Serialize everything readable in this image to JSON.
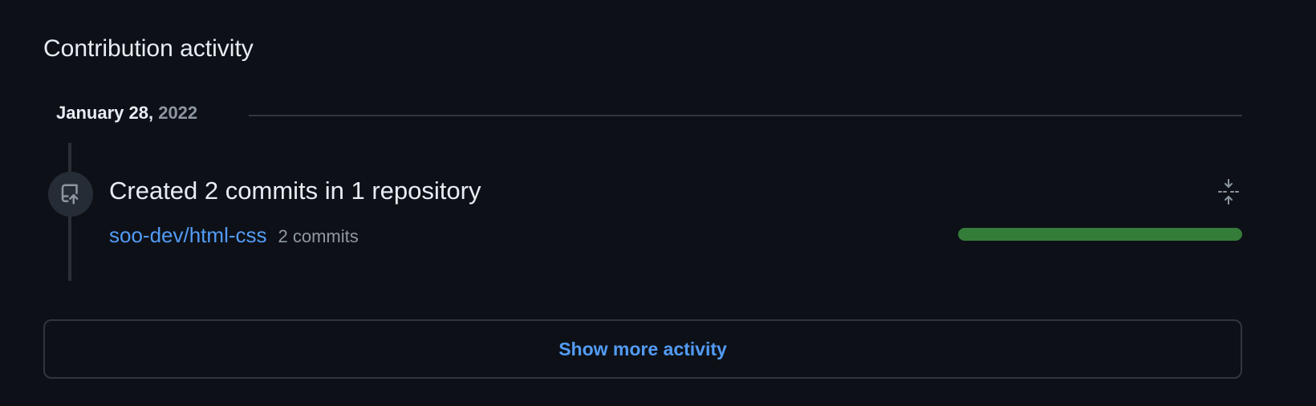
{
  "section": {
    "title": "Contribution activity"
  },
  "timeline": {
    "date": {
      "month_day": "January 28,",
      "year": "2022"
    },
    "event": {
      "icon": "repo-push-icon",
      "title": "Created 2 commits in 1 repository",
      "collapse_icon": "fold-icon",
      "repositories": [
        {
          "name": "soo-dev/html-css",
          "commits_label": "2 commits",
          "activity_fraction": 1.0
        }
      ]
    }
  },
  "show_more": {
    "label": "Show more activity"
  },
  "colors": {
    "background": "#0d1117",
    "link": "#539bf5",
    "progress": "#347d39",
    "border": "#30363d"
  }
}
